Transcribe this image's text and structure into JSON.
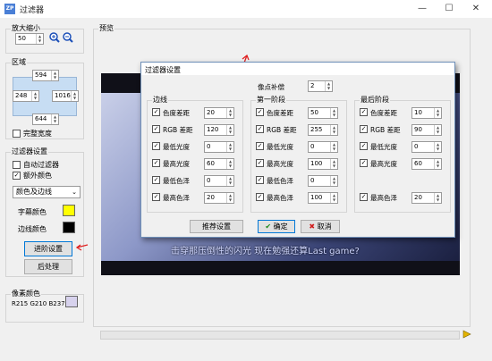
{
  "window": {
    "title": "过滤器",
    "icon_text": "ZP",
    "minimize": "—",
    "maximize": "☐",
    "close": "✕"
  },
  "zoom": {
    "group_label": "放大缩小",
    "value": "50",
    "zoom_in_icon": "zoom-in-icon",
    "zoom_out_icon": "zoom-out-icon"
  },
  "region": {
    "group_label": "区域",
    "top": "594",
    "left": "248",
    "right": "1016",
    "bottom": "644",
    "full_width_label": "完整宽度"
  },
  "filter": {
    "group_label": "过滤器设置",
    "auto_filter_label": "自动过滤器",
    "extra_color_label": "额外颜色",
    "auto_filter_checked": false,
    "extra_color_checked": true,
    "mode_select": "颜色及边线",
    "subtitle_color_label": "字幕颜色",
    "subtitle_color": "#ffff00",
    "border_color_label": "边线颜色",
    "border_color": "#000000",
    "advanced_button": "进阶设置",
    "postprocess_button": "后处理"
  },
  "pixel_color": {
    "group_label": "像素颜色",
    "value": "R215 G210 B237",
    "swatch": "#d7d2ed"
  },
  "preview": {
    "group_label": "预览",
    "subtitle_text": "击穿那压倒性的闪光 现在勉强还算Last game?",
    "play_icon": "play-icon"
  },
  "dialog": {
    "title": "过滤器设置",
    "pixel_comp_label": "像点补偿",
    "pixel_comp_value": "2",
    "edge": {
      "label": "边线",
      "rows": [
        {
          "label": "色度差距",
          "value": "20",
          "checked": true
        },
        {
          "label": "RGB 差距",
          "value": "120",
          "checked": true
        },
        {
          "label": "最低光度",
          "value": "0",
          "checked": true
        },
        {
          "label": "最高光度",
          "value": "60",
          "checked": true
        },
        {
          "label": "最低色泽",
          "value": "0",
          "checked": true
        },
        {
          "label": "最高色泽",
          "value": "20",
          "checked": true
        }
      ]
    },
    "stage1": {
      "label": "第一阶段",
      "rows": [
        {
          "label": "色度差距",
          "value": "50",
          "checked": true
        },
        {
          "label": "RGB 差距",
          "value": "255",
          "checked": true
        },
        {
          "label": "最低光度",
          "value": "0",
          "checked": true
        },
        {
          "label": "最高光度",
          "value": "100",
          "checked": true
        },
        {
          "label": "最低色泽",
          "value": "0",
          "checked": true
        },
        {
          "label": "最高色泽",
          "value": "100",
          "checked": true
        }
      ]
    },
    "final": {
      "label": "最后阶段",
      "rows": [
        {
          "label": "色度差距",
          "value": "10",
          "checked": true
        },
        {
          "label": "RGB 差距",
          "value": "90",
          "checked": true
        },
        {
          "label": "最低光度",
          "value": "0",
          "checked": true
        },
        {
          "label": "最高光度",
          "value": "60",
          "checked": true
        },
        {
          "label": "最高色泽",
          "value": "20",
          "checked": true
        }
      ]
    },
    "recommend_button": "推荐设置",
    "ok_button": "确定",
    "cancel_button": "取消"
  },
  "colors": {
    "dialog_border": "#6e8fb8",
    "annotation_arrow": "#e02020"
  }
}
